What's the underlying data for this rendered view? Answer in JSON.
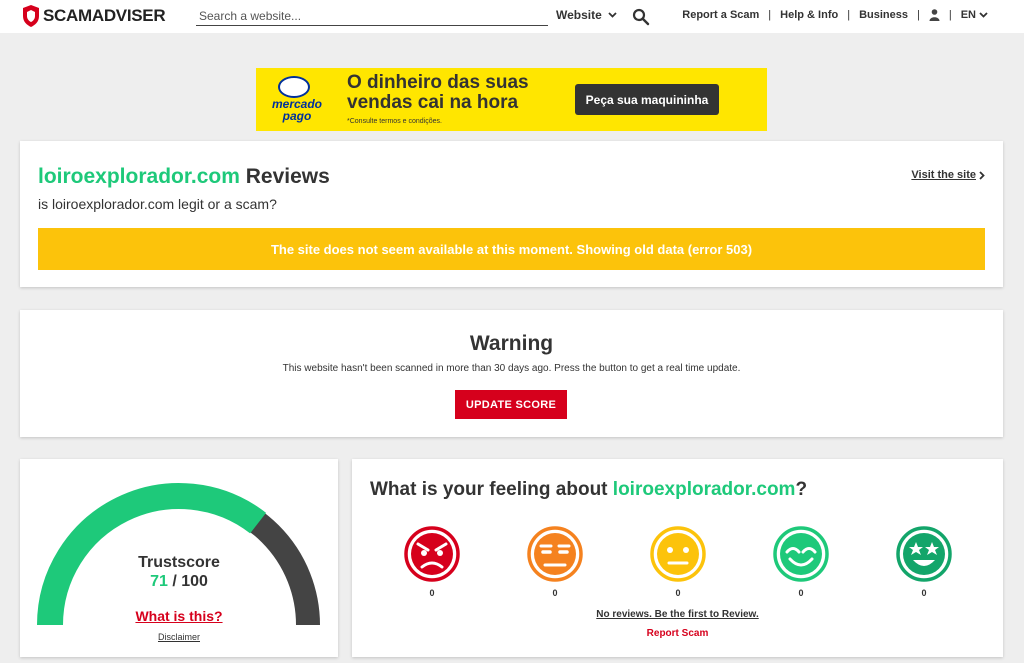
{
  "header": {
    "logo_text": "SCAMADVISER",
    "search_placeholder": "Search a website...",
    "search_type": "Website",
    "nav": {
      "report": "Report a Scam",
      "help": "Help & Info",
      "business": "Business",
      "lang": "EN"
    },
    "separator": "|"
  },
  "ad": {
    "brand": "mercado pago",
    "headline": "O dinheiro das suas vendas cai na hora",
    "footnote": "*Consulte termos e condições.",
    "cta": "Peça sua maquininha",
    "color": "#ffe600"
  },
  "reviews": {
    "domain": "loiroexplorador.com",
    "title_suffix": "Reviews",
    "subtitle": "is loiroexplorador.com legit or a scam?",
    "visit": "Visit the site",
    "alert": "The site does not seem available at this moment. Showing old data (error 503)"
  },
  "warning": {
    "title": "Warning",
    "text": "This website hasn't been scanned in more than 30 days ago. Press the button to get a real time update.",
    "button": "UPDATE SCORE"
  },
  "trust": {
    "label": "Trustscore",
    "score": "71",
    "max": "/ 100",
    "score_fraction": 0.71,
    "what": "What is this?",
    "disclaimer": "Disclaimer"
  },
  "feeling": {
    "question": "What is your feeling about ",
    "domain": "loiroexplorador.com",
    "question_end": "?",
    "faces": [
      {
        "mood": "angry",
        "count": "0",
        "color": "#d6001c"
      },
      {
        "mood": "annoyed",
        "count": "0",
        "color": "#f5821f"
      },
      {
        "mood": "neutral",
        "count": "0",
        "color": "#fcc30b"
      },
      {
        "mood": "happy",
        "count": "0",
        "color": "#1ec97a"
      },
      {
        "mood": "star-eyes",
        "count": "0",
        "color": "#13a56a"
      }
    ],
    "no_reviews": "No reviews. Be the first to Review.",
    "report": "Report Scam"
  },
  "colors": {
    "accent_green": "#1ec97a",
    "brand_red": "#d6001c",
    "alert_yellow": "#fcc30b",
    "gauge_dark": "#444444"
  }
}
